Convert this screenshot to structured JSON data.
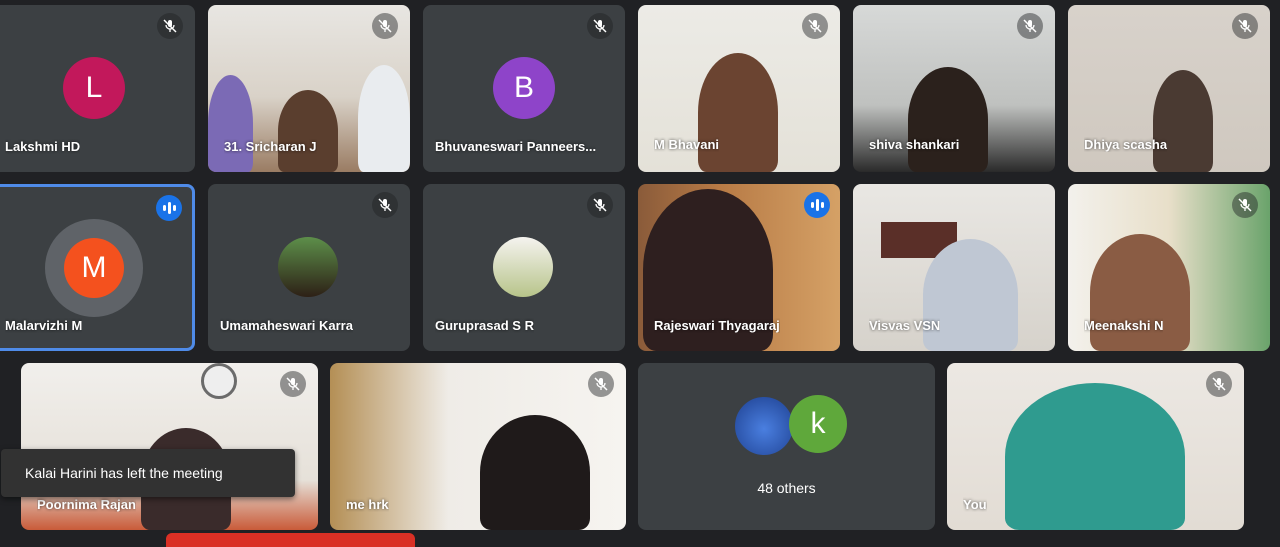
{
  "participants": [
    {
      "name": "Lakshmi HD",
      "initial": "L",
      "avatar_color": "#c2185b"
    },
    {
      "name": "31. Sricharan J"
    },
    {
      "name": "Bhuvaneswari Panneers...",
      "initial": "B",
      "avatar_color": "#8e44c9"
    },
    {
      "name": "M Bhavani"
    },
    {
      "name": "shiva shankari"
    },
    {
      "name": "Dhiya scasha"
    },
    {
      "name": "Malarvizhi M",
      "initial": "M",
      "avatar_color": "#f4511e"
    },
    {
      "name": "Umamaheswari Karra"
    },
    {
      "name": "Guruprasad S R"
    },
    {
      "name": "Rajeswari Thyagaraj"
    },
    {
      "name": "Visvas VSN"
    },
    {
      "name": "Meenakshi N"
    },
    {
      "name": "Poornima Rajan"
    },
    {
      "name": "me hrk"
    },
    {
      "name": "You"
    }
  ],
  "others": {
    "label": "48 others",
    "initial": "k",
    "avatar_color": "#5fa83b"
  },
  "toast": {
    "message": "Kalai Harini has left the meeting"
  },
  "colors": {
    "background": "#202124",
    "tile": "#3c4043",
    "active_border": "#4f8be8",
    "speaking": "#1a73e8"
  }
}
